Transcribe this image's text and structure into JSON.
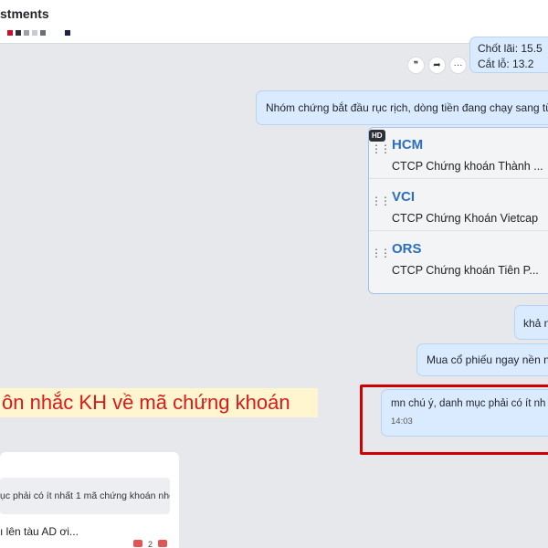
{
  "header": {
    "title": "stments",
    "avatar_colors": [
      "#c8102e",
      "#2b2f3a",
      "#9aa0a8",
      "#c7cbd1",
      "#6b7078",
      "#1a2440"
    ]
  },
  "top_bubble": {
    "line1": "Chốt lãi: 15.5",
    "line2": "Cắt lỗ: 13.2"
  },
  "message_actions": {
    "quote_icon": "❞",
    "forward_icon": "➦",
    "more_icon": "···"
  },
  "messages": {
    "group_start": "Nhóm chứng bắt đầu rục rịch, dòng tiền đang chạy sang từ n",
    "kha": "khả n",
    "mua": "Mua cổ phiếu ngay nền nề",
    "mn_text": "mn chú ý, danh mục phải có ít nh",
    "mn_time": "14:03"
  },
  "stock_card": {
    "badge": "HD",
    "stocks": [
      {
        "ticker": "HCM",
        "company": "CTCP Chứng khoán Thành ..."
      },
      {
        "ticker": "VCI",
        "company": "CTCP Chứng Khoán Vietcap"
      },
      {
        "ticker": "ORS",
        "company": "CTCP Chứng khoán Tiên P..."
      }
    ]
  },
  "caption": "ôn nhắc KH về mã chứng khoán",
  "reply_card": {
    "quoted": "ục phải có ít nhất 1 mã chứng khoán nhé",
    "text": "ı lên tàu AD ơi...",
    "reaction_count": "2"
  },
  "colors": {
    "accent": "#2c6fc1",
    "bubble": "#dbebff",
    "highlight_red": "#d00000",
    "caption_bg": "#fff6cf"
  }
}
